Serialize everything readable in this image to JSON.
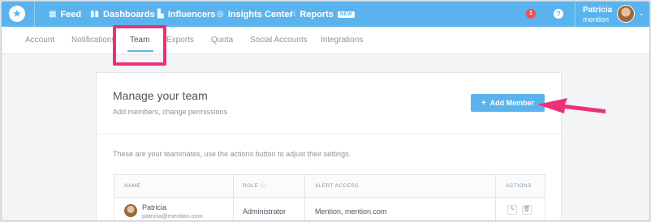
{
  "topbar": {
    "logo_glyph": "★",
    "nav": [
      {
        "label": "Feed",
        "icon": "feed-icon",
        "glyph": "▦"
      },
      {
        "label": "Dashboards",
        "icon": "bar-chart-icon",
        "glyph": "▮▮"
      },
      {
        "label": "Influencers",
        "icon": "people-icon",
        "glyph": "▙"
      },
      {
        "label": "Insights Center",
        "icon": "insights-icon",
        "glyph": "◎"
      },
      {
        "label": "Reports",
        "icon": "grid-icon",
        "glyph": "⁝⁝",
        "badge": "NEW"
      }
    ],
    "notification_count": "1",
    "help_glyph": "?",
    "user": {
      "name": "Patricia",
      "org": "mention"
    },
    "caret": "⌄"
  },
  "tabs": [
    "Account",
    "Notifications",
    "Team",
    "Exports",
    "Quota",
    "Social Accounts",
    "Integrations"
  ],
  "active_tab": "Team",
  "card": {
    "title": "Manage your team",
    "subtitle": "Add members, change permissions",
    "add_button": "Add Member",
    "add_glyph": "+",
    "hint": "These are your teammates, use the actions button to adjust their settings."
  },
  "table": {
    "headers": {
      "name": "NAME",
      "role": "ROLE",
      "alert_access": "ALERT ACCESS",
      "actions": "ACTIONS"
    },
    "role_info_glyph": "ⓘ",
    "rows": [
      {
        "name": "Patricia",
        "email": "patricia@mention.com",
        "role": "Administrator",
        "alert_access": "Mention, mention.com"
      }
    ],
    "edit_glyph": "✎",
    "delete_glyph": "🗑"
  },
  "colors": {
    "accent": "#5bb3ee",
    "highlight": "#ee2f79",
    "notification": "#f0504f"
  }
}
